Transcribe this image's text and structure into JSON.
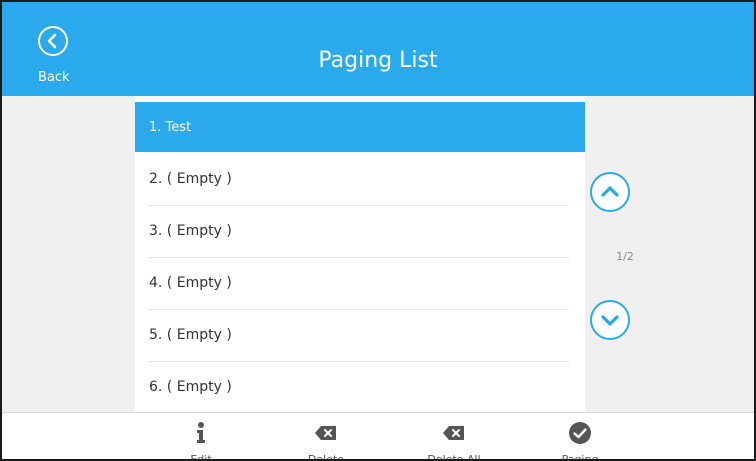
{
  "header": {
    "title": "Paging List",
    "back_label": "Back"
  },
  "list": {
    "items": [
      {
        "label": "1. Test",
        "selected": true
      },
      {
        "label": "2. ( Empty )",
        "selected": false
      },
      {
        "label": "3. ( Empty )",
        "selected": false
      },
      {
        "label": "4. ( Empty )",
        "selected": false
      },
      {
        "label": "5. ( Empty )",
        "selected": false
      },
      {
        "label": "6. ( Empty )",
        "selected": false
      }
    ]
  },
  "pager": {
    "indicator": "1/2",
    "up_icon": "chevron-up-icon",
    "down_icon": "chevron-down-icon"
  },
  "toolbar": {
    "edit_label": "Edit",
    "delete_label": "Delete",
    "delete_all_label": "Delete All",
    "paging_label": "Paging"
  },
  "colors": {
    "accent": "#2aa9ec",
    "side_panel": "#f0f0f0",
    "icon_dark": "#555555"
  }
}
